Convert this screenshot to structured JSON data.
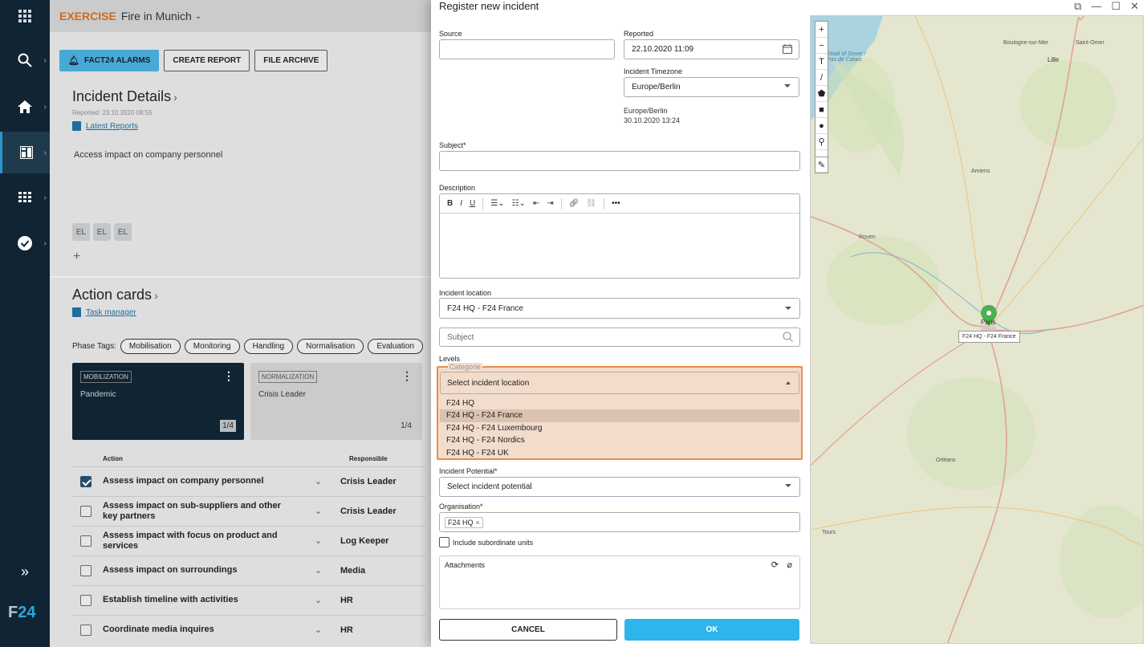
{
  "app": {
    "exercise_label": "EXERCISE",
    "title": "Fire in Munich",
    "toolbar": {
      "alarms": "FACT24 ALARMS",
      "create_report": "CREATE REPORT",
      "file_archive": "FILE ARCHIVE"
    },
    "incident_details": {
      "title": "Incident Details",
      "reported": "Reported: 23.10.2020 08:55",
      "latest_reports": "Latest Reports",
      "text": "Access impact on company personnel",
      "chips": [
        "EL",
        "EL",
        "EL"
      ],
      "add": "+"
    },
    "action_cards": {
      "title": "Action cards",
      "task_manager": "Task manager",
      "phase_label": "Phase Tags:",
      "phases": [
        "Mobilisation",
        "Monitoring",
        "Handling",
        "Normalisation",
        "Evaluation"
      ],
      "cards": [
        {
          "tag": "MOBILIZATION",
          "name": "Pandemic",
          "page": "1/4"
        },
        {
          "tag": "NORMALIZATION",
          "name": "Crisis Leader",
          "page": "1/4"
        }
      ],
      "columns": {
        "action": "Action",
        "responsible": "Responsible"
      },
      "rows": [
        {
          "action": "Assess impact on company personnel",
          "responsible": "Crisis Leader",
          "checked": true
        },
        {
          "action": "Assess impact on sub-suppliers and other key partners",
          "responsible": "Crisis Leader",
          "checked": false
        },
        {
          "action": "Assess impact with focus on product and services",
          "responsible": "Log Keeper",
          "checked": false
        },
        {
          "action": "Assess impact on surroundings",
          "responsible": "Media",
          "checked": false
        },
        {
          "action": "Establish timeline with activities",
          "responsible": "HR",
          "checked": false
        },
        {
          "action": "Coordinate media inquires",
          "responsible": "HR",
          "checked": false
        }
      ]
    },
    "logo": {
      "f": "F",
      "num": "24"
    }
  },
  "modal": {
    "title": "Register new incident",
    "source": {
      "label": "Source",
      "value": ""
    },
    "reported": {
      "label": "Reported",
      "value": "22.10.2020 11:09"
    },
    "timezone": {
      "label": "Incident Timezone",
      "value": "Europe/Berlin"
    },
    "tz_info": {
      "zone": "Europe/Berlin",
      "time": "30.10.2020 13:24"
    },
    "subject": {
      "label": "Subject*",
      "value": ""
    },
    "description": {
      "label": "Description",
      "more": "•••"
    },
    "location": {
      "label": "Incident location",
      "value": "F24 HQ - F24 France"
    },
    "search": {
      "placeholder": "Subject"
    },
    "levels": {
      "label": "Levels"
    },
    "category": {
      "legend": "Categorie",
      "value": "Select incident location",
      "options": [
        "F24 HQ",
        "F24 HQ - F24 France",
        "F24 HQ - F24 Luxembourg",
        "F24 HQ - F24 Nordics",
        "F24 HQ - F24 UK"
      ],
      "selected_index": 1
    },
    "potential": {
      "label": "Incident Potential*",
      "value": "Select incident potential"
    },
    "organisation": {
      "label": "Organisation*",
      "chip": "F24 HQ",
      "chip_close": "×"
    },
    "include_sub": "Include subordinate units",
    "attachments": {
      "label": "Attachments"
    },
    "buttons": {
      "cancel": "CANCEL",
      "ok": "OK"
    }
  },
  "map": {
    "controls": [
      "+",
      "−",
      "T",
      "/",
      "⬟",
      "■",
      "●",
      "⚲",
      "✎"
    ],
    "pin_label": "F24 HQ - F24 France",
    "cities": [
      {
        "name": "Boulogne-sur-Mer"
      },
      {
        "name": "Saint-Omer"
      },
      {
        "name": "Lille"
      },
      {
        "name": "Strait of Dover / Pas de Calais"
      },
      {
        "name": "Amiens"
      },
      {
        "name": "Rouen"
      },
      {
        "name": "Paris"
      },
      {
        "name": "Orléans"
      },
      {
        "name": "Tours"
      }
    ]
  },
  "colors": {
    "rail": "#102433",
    "accent": "#2eb5eb",
    "highlight_border": "#e88d4a",
    "pin": "#4caf50"
  }
}
